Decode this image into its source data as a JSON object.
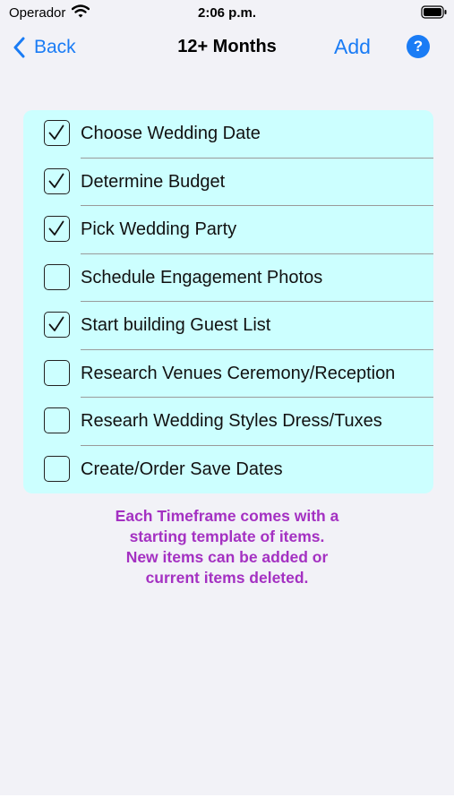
{
  "status_bar": {
    "carrier": "Operador",
    "time": "2:06 p.m."
  },
  "nav": {
    "back_label": "Back",
    "title": "12+ Months",
    "add_label": "Add",
    "help_label": "?"
  },
  "colors": {
    "accent": "#1a7cf5",
    "list_background": "#ccffff",
    "note_text": "#a431c2"
  },
  "checklist": [
    {
      "label": "Choose Wedding Date",
      "checked": true
    },
    {
      "label": "Determine Budget",
      "checked": true
    },
    {
      "label": "Pick Wedding Party",
      "checked": true
    },
    {
      "label": "Schedule Engagement Photos",
      "checked": false
    },
    {
      "label": "Start building Guest List",
      "checked": true
    },
    {
      "label": "Research Venues Ceremony/Reception",
      "checked": false
    },
    {
      "label": "Researh Wedding Styles Dress/Tuxes",
      "checked": false
    },
    {
      "label": "Create/Order Save Dates",
      "checked": false
    }
  ],
  "note": {
    "lines": [
      "Each Timeframe comes with a",
      "starting template of items.",
      "New items can be added or",
      "current items deleted."
    ]
  }
}
